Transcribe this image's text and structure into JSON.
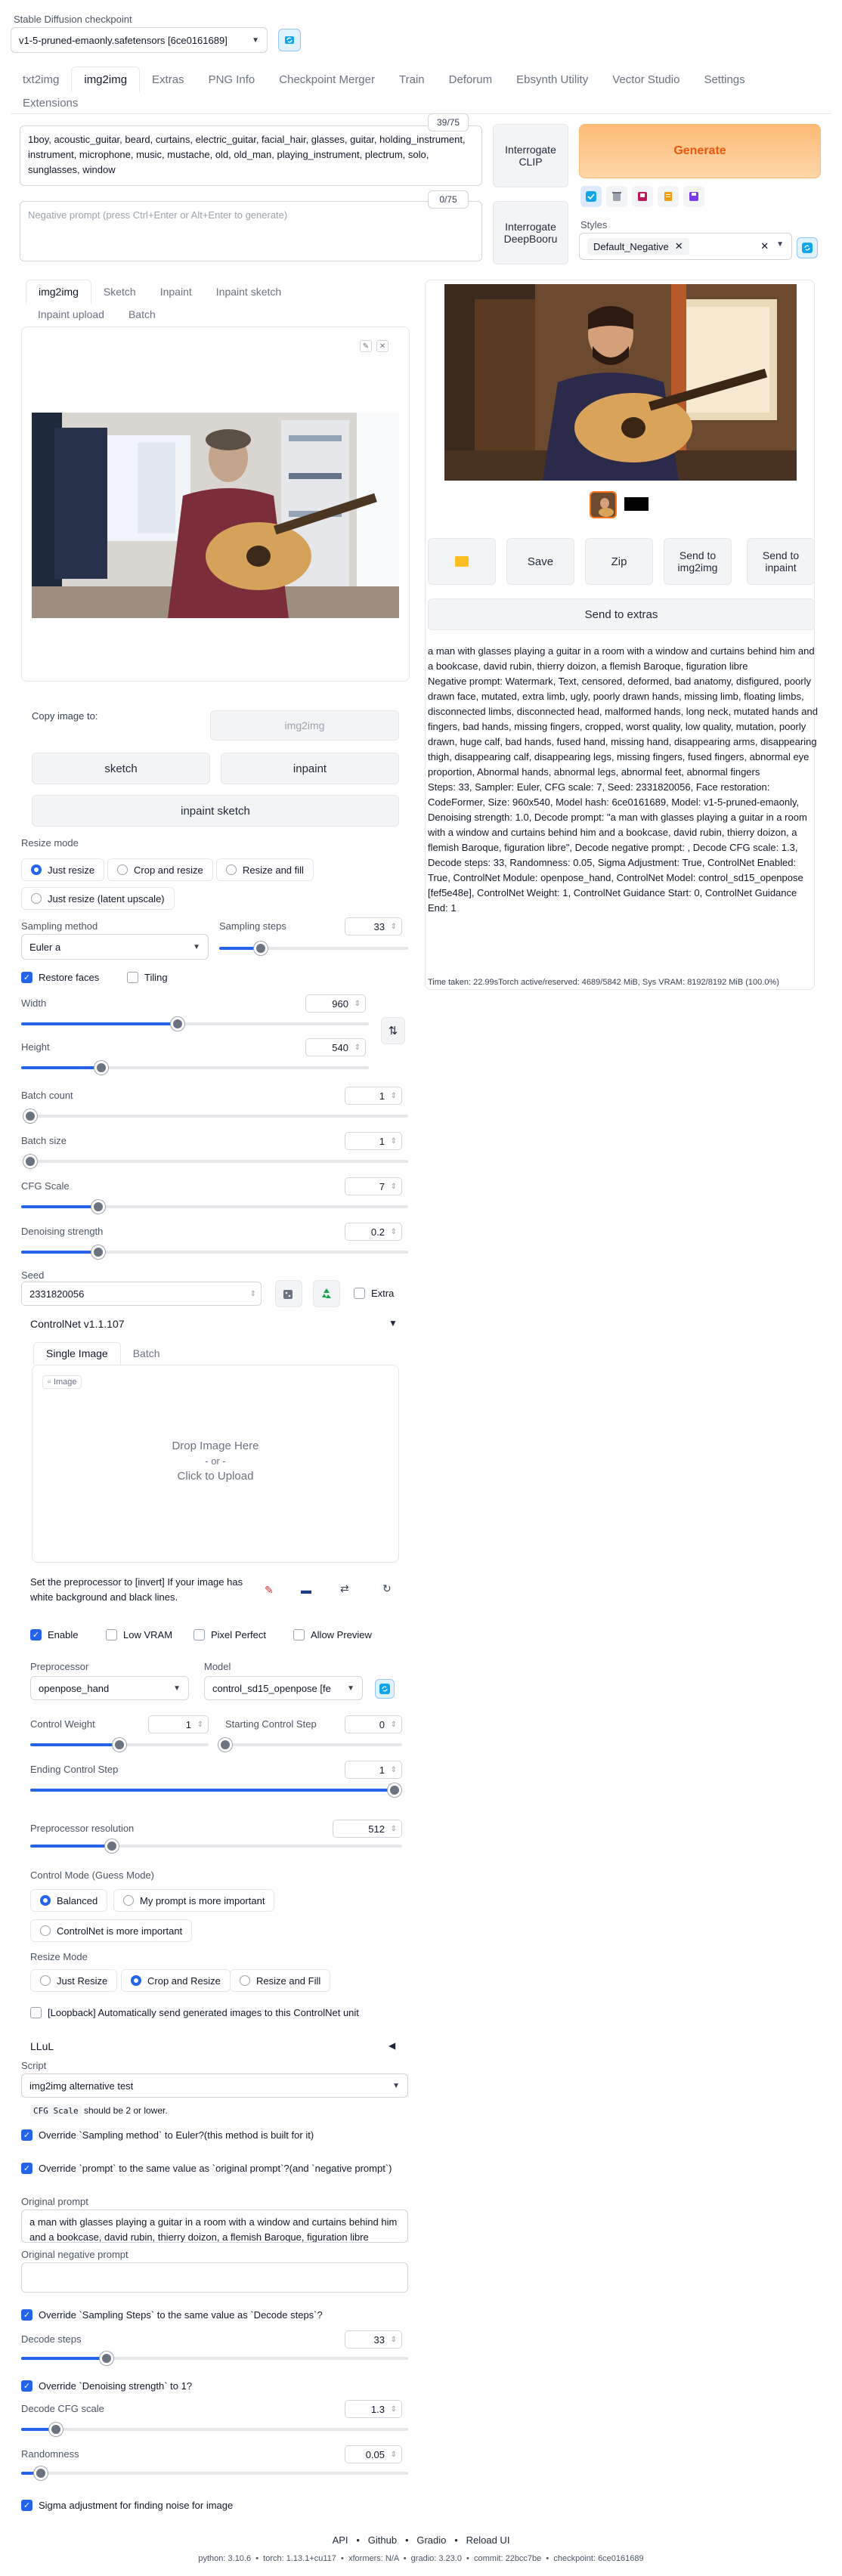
{
  "header": {
    "checkpoint_label": "Stable Diffusion checkpoint",
    "checkpoint_value": "v1-5-pruned-emaonly.safetensors [6ce0161689]"
  },
  "main_tabs": [
    "txt2img",
    "img2img",
    "Extras",
    "PNG Info",
    "Checkpoint Merger",
    "Train",
    "Deforum",
    "Ebsynth Utility",
    "Vector Studio",
    "Settings",
    "Extensions"
  ],
  "prompt": {
    "text": "1boy, acoustic_guitar, beard, curtains, electric_guitar, facial_hair, glasses, guitar, holding_instrument, instrument, microphone, music, mustache, old, old_man, playing_instrument, plectrum, solo, sunglasses, window",
    "count": "39/75"
  },
  "negative": {
    "placeholder": "Negative prompt (press Ctrl+Enter or Alt+Enter to generate)",
    "count": "0/75"
  },
  "buttons": {
    "interrogate_clip": "Interrogate CLIP",
    "interrogate_deepbooru": "Interrogate DeepBooru",
    "generate": "Generate"
  },
  "styles": {
    "label": "Styles",
    "chip": "Default_Negative"
  },
  "sub_tabs": [
    "img2img",
    "Sketch",
    "Inpaint",
    "Inpaint sketch",
    "Inpaint upload",
    "Batch"
  ],
  "copy": {
    "label": "Copy image to:",
    "img2img": "img2img",
    "sketch": "sketch",
    "inpaint": "inpaint",
    "inpaint_sketch": "inpaint sketch"
  },
  "resize_mode": {
    "label": "Resize mode",
    "options": [
      "Just resize",
      "Crop and resize",
      "Resize and fill",
      "Just resize (latent upscale)"
    ]
  },
  "sampling": {
    "method_label": "Sampling method",
    "method": "Euler a",
    "steps_label": "Sampling steps",
    "steps": "33",
    "steps_frac": 0.22
  },
  "toggles": {
    "restore_faces": "Restore faces",
    "tiling": "Tiling"
  },
  "width": {
    "label": "Width",
    "value": "960",
    "frac": 0.45
  },
  "height": {
    "label": "Height",
    "value": "540",
    "frac": 0.23
  },
  "batch_count": {
    "label": "Batch count",
    "value": "1",
    "frac": 0.0
  },
  "batch_size": {
    "label": "Batch size",
    "value": "1",
    "frac": 0.0
  },
  "cfg": {
    "label": "CFG Scale",
    "value": "7",
    "frac": 0.2
  },
  "denoise": {
    "label": "Denoising strength",
    "value": "0.2",
    "frac": 0.2
  },
  "seed": {
    "label": "Seed",
    "value": "2331820056",
    "extra": "Extra"
  },
  "controlnet": {
    "title": "ControlNet v1.1.107",
    "tabs": [
      "Single Image",
      "Batch"
    ],
    "image_label": "Image",
    "drop": "Drop Image Here",
    "or": "- or -",
    "click": "Click to Upload",
    "note": "Set the preprocessor to [invert] If your image has white background and black lines.",
    "checks": [
      "Enable",
      "Low VRAM",
      "Pixel Perfect",
      "Allow Preview"
    ],
    "preprocessor_label": "Preprocessor",
    "preprocessor": "openpose_hand",
    "model_label": "Model",
    "model": "control_sd15_openpose [fe",
    "weight_label": "Control Weight",
    "weight": "1",
    "weight_frac": 0.5,
    "start_label": "Starting Control Step",
    "start": "0",
    "start_frac": 0.0,
    "end_label": "Ending Control Step",
    "end": "1",
    "end_frac": 1.0,
    "res_label": "Preprocessor resolution",
    "res": "512",
    "res_frac": 0.22,
    "mode_label": "Control Mode (Guess Mode)",
    "modes": [
      "Balanced",
      "My prompt is more important",
      "ControlNet is more important"
    ],
    "resize_label": "Resize Mode",
    "resizes": [
      "Just Resize",
      "Crop and Resize",
      "Resize and Fill"
    ],
    "loopback": "[Loopback] Automatically send generated images to this ControlNet unit"
  },
  "llul": "LLuL",
  "script": {
    "label": "Script",
    "value": "img2img alternative test",
    "warn_code": "CFG Scale",
    "warn_rest": " should be 2 or lower.",
    "o1": "Override `Sampling method` to Euler?(this method is built for it)",
    "o2": "Override `prompt` to the same value as `original prompt`?(and `negative prompt`)",
    "orig_label": "Original prompt",
    "orig": "a man with glasses playing a guitar in a room with a window and curtains behind him and a bookcase, david rubin, thierry doizon, a flemish Baroque, figuration libre",
    "orig_neg_label": "Original negative prompt",
    "o3": "Override `Sampling Steps` to the same value as `Decode steps`?",
    "decode_steps_label": "Decode steps",
    "decode_steps": "33",
    "decode_steps_frac": 0.22,
    "o4": "Override `Denoising strength` to 1?",
    "decode_cfg_label": "Decode CFG scale",
    "decode_cfg": "1.3",
    "decode_cfg_frac": 0.09,
    "rand_label": "Randomness",
    "rand": "0.05",
    "rand_frac": 0.05,
    "sigma": "Sigma adjustment for finding noise for image"
  },
  "output": {
    "save": "Save",
    "zip": "Zip",
    "send_img2img": "Send to img2img",
    "send_inpaint": "Send to inpaint",
    "send_extras": "Send to extras",
    "info1": "a man with glasses playing a guitar in a room with a window and curtains behind him and a bookcase, david rubin, thierry doizon, a flemish Baroque, figuration libre",
    "info2": "Negative prompt: Watermark, Text, censored, deformed, bad anatomy, disfigured, poorly drawn face, mutated, extra limb, ugly, poorly drawn hands, missing limb, floating limbs, disconnected limbs, disconnected head, malformed hands, long neck, mutated hands and fingers, bad hands, missing fingers, cropped, worst quality, low quality, mutation, poorly drawn, huge calf, bad hands, fused hand, missing hand, disappearing arms, disappearing thigh, disappearing calf, disappearing legs, missing fingers, fused fingers, abnormal eye proportion, Abnormal hands, abnormal legs, abnormal feet, abnormal fingers",
    "info3": "Steps: 33, Sampler: Euler, CFG scale: 7, Seed: 2331820056, Face restoration: CodeFormer, Size: 960x540, Model hash: 6ce0161689, Model: v1-5-pruned-emaonly, Denoising strength: 1.0, Decode prompt: \"a man with glasses playing a guitar in a room with a window and curtains behind him and a bookcase, david rubin, thierry doizon, a flemish Baroque, figuration libre\", Decode negative prompt: , Decode CFG scale: 1.3, Decode steps: 33, Randomness: 0.05, Sigma Adjustment: True, ControlNet Enabled: True, ControlNet Module: openpose_hand, ControlNet Model: control_sd15_openpose [fef5e48e], ControlNet Weight: 1, ControlNet Guidance Start: 0, ControlNet Guidance End: 1",
    "time": "Time taken: 22.99sTorch active/reserved: 4689/5842 MiB, Sys VRAM: 8192/8192 MiB (100.0%)"
  },
  "footer": {
    "links": [
      "API",
      "Github",
      "Gradio",
      "Reload UI"
    ],
    "versions": "python: 3.10.6  •  torch: 1.13.1+cu117  •  xformers: N/A  •  gradio: 3.23.0  •  commit: 22bcc7be  •  checkpoint: 6ce0161689"
  }
}
